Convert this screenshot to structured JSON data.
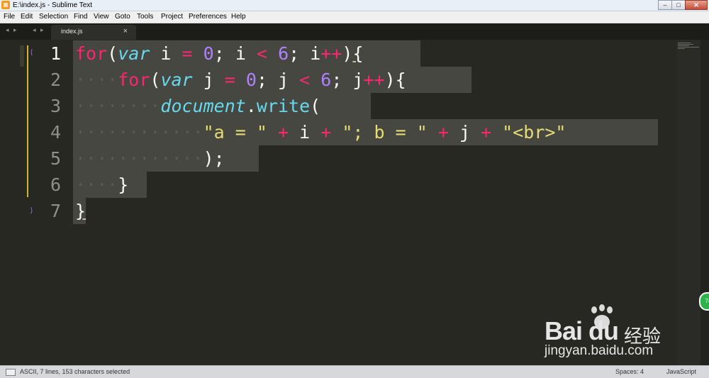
{
  "window": {
    "title": "E:\\index.js - Sublime Text"
  },
  "menu": [
    "File",
    "Edit",
    "Selection",
    "Find",
    "View",
    "Goto",
    "Tools",
    "Project",
    "Preferences",
    "Help"
  ],
  "tabs": [
    {
      "label": "index.js",
      "close": "×"
    }
  ],
  "nav": {
    "back": "◂ ▸",
    "tabs": "◂ ▸"
  },
  "editor": {
    "line_numbers": [
      "1",
      "2",
      "3",
      "4",
      "5",
      "6",
      "7"
    ],
    "lines": [
      "for(var i = 0; i < 6; i++){",
      "    for(var j = 0; j < 6; j++){",
      "        document.write(",
      "            \"a = \" + i + \"; b = \" + j + \"<br>\"",
      "            );",
      "    }",
      "}"
    ]
  },
  "status": {
    "left": "ASCII, 7 lines, 153 characters selected",
    "spaces": "Spaces: 4",
    "syntax": "JavaScript"
  },
  "watermark": {
    "brand": "Bai du",
    "cn": "经验",
    "url": "jingyan.baidu.com"
  },
  "badge": "74",
  "colors": {
    "background": "#272822",
    "keyword": "#f92672",
    "storage": "#66d9ef",
    "number": "#ae81ff",
    "string": "#e6db74",
    "selection": "#474741",
    "change_bar": "#d3b334"
  }
}
